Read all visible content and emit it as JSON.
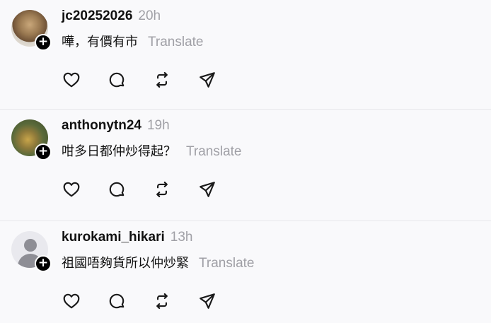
{
  "posts": [
    {
      "username": "jc20252026",
      "time": "20h",
      "text": "嘩，有價有市",
      "translate_label": "Translate",
      "avatar": "photo-avatar"
    },
    {
      "username": "anthonytn24",
      "time": "19h",
      "text": "咁多日都仲炒得起？",
      "translate_label": "Translate",
      "avatar": "photo-avatar"
    },
    {
      "username": "kurokami_hikari",
      "time": "13h",
      "text": "祖國唔夠貨所以仲炒緊",
      "translate_label": "Translate",
      "avatar": "default-avatar"
    }
  ],
  "follow_badge": "+",
  "actions": [
    "heart-icon",
    "comment-icon",
    "repost-icon",
    "share-icon"
  ],
  "colors": {
    "background": "#f9f9fb",
    "text": "#111111",
    "muted": "#a0a0a6",
    "divider": "#e7e7ea"
  }
}
